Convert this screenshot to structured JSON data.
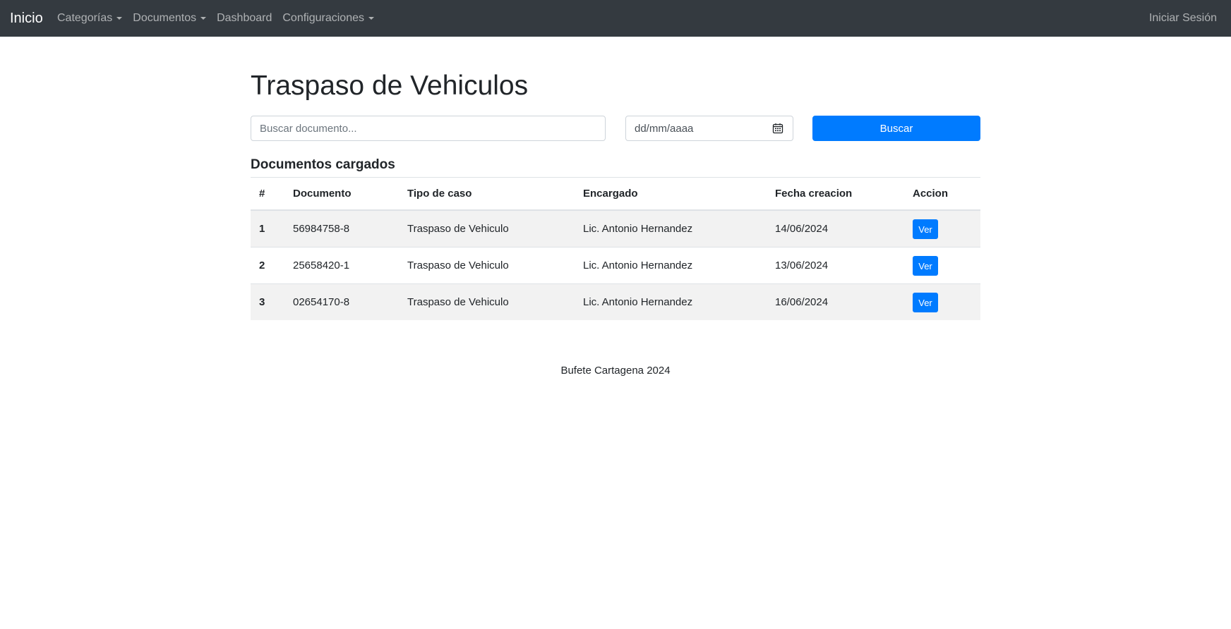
{
  "navbar": {
    "brand": "Inicio",
    "links": [
      {
        "label": "Categorías",
        "dropdown": true
      },
      {
        "label": "Documentos",
        "dropdown": true
      },
      {
        "label": "Dashboard",
        "dropdown": false
      },
      {
        "label": "Configuraciones",
        "dropdown": true
      }
    ],
    "login": "Iniciar Sesión"
  },
  "page": {
    "title": "Traspaso de Vehiculos"
  },
  "filters": {
    "search_placeholder": "Buscar documento...",
    "search_value": "",
    "date_placeholder": "dd/mm/aaaa",
    "search_button": "Buscar"
  },
  "section_title": "Documentos cargados",
  "table": {
    "headers": [
      "#",
      "Documento",
      "Tipo de caso",
      "Encargado",
      "Fecha creacion",
      "Accion"
    ],
    "rows": [
      {
        "num": "1",
        "documento": "56984758-8",
        "tipo": "Traspaso de Vehiculo",
        "encargado": "Lic. Antonio Hernandez",
        "fecha": "14/06/2024",
        "accion": "Ver"
      },
      {
        "num": "2",
        "documento": "25658420-1",
        "tipo": "Traspaso de Vehiculo",
        "encargado": "Lic. Antonio Hernandez",
        "fecha": "13/06/2024",
        "accion": "Ver"
      },
      {
        "num": "3",
        "documento": "02654170-8",
        "tipo": "Traspaso de Vehiculo",
        "encargado": "Lic. Antonio Hernandez",
        "fecha": "16/06/2024",
        "accion": "Ver"
      }
    ]
  },
  "footer": "Bufete Cartagena 2024",
  "colors": {
    "navbar_bg": "#343a40",
    "primary": "#007bff",
    "stripe": "#f2f2f2"
  }
}
